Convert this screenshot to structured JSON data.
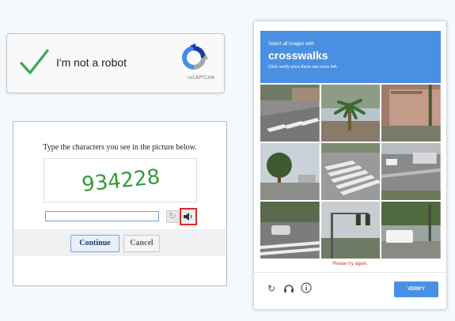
{
  "checkbox_widget": {
    "label": "I'm not a robot",
    "brand": "reCAPTCHA",
    "check_color": "#3aa757"
  },
  "text_captcha": {
    "instruction": "Type the characters you see in the picture below.",
    "code": "934228",
    "code_color": "#2f9e3a",
    "input_value": "",
    "continue_label": "Continue",
    "cancel_label": "Cancel",
    "highlight_color": "#e0282e"
  },
  "image_challenge": {
    "header_line1": "Select all images with",
    "header_keyword": "crosswalks",
    "header_line3": "Click verify once there are none left.",
    "header_color": "#4a90e2",
    "tiles": [
      "crosswalk-street",
      "palm-tree-street",
      "building-wall",
      "tree-parking",
      "crosswalk-intersection",
      "road-trucks",
      "street-cars",
      "traffic-light",
      "parked-truck"
    ],
    "error_message": "Please try again.",
    "verify_label": "VERIFY"
  }
}
